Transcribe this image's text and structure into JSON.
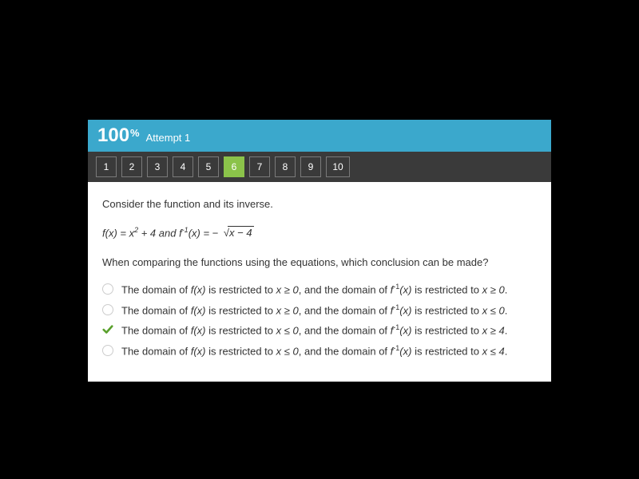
{
  "header": {
    "score": "100",
    "percent": "%",
    "attempt": "Attempt 1"
  },
  "nav": {
    "items": [
      "1",
      "2",
      "3",
      "4",
      "5",
      "6",
      "7",
      "8",
      "9",
      "10"
    ],
    "active_index": 5
  },
  "content": {
    "prompt": "Consider the function and its inverse.",
    "eq_fx_pre": "f(x) = x",
    "eq_fx_sup": "2",
    "eq_fx_mid": " + 4  and  f",
    "eq_finv_sup": "-1",
    "eq_finv_mid": "(x) =  − ",
    "eq_sqrt_body": "x − 4",
    "question": "When comparing the functions using the equations, which conclusion can be made?",
    "options": [
      {
        "correct": false,
        "text_pre": "The domain of ",
        "fx": "f(x)",
        "mid1": " is restricted to ",
        "cond1": "x ≥ 0",
        "mid2": ", and the domain of ",
        "finv_pre": "f",
        "finv_sup": "-1",
        "finv_post": "(x)",
        "mid3": " is restricted to  ",
        "cond2": "x ≥ 0",
        "end": "."
      },
      {
        "correct": false,
        "text_pre": "The domain of ",
        "fx": "f(x)",
        "mid1": " is restricted to ",
        "cond1": "x ≥ 0",
        "mid2": ", and the domain of ",
        "finv_pre": "f",
        "finv_sup": "-1",
        "finv_post": "(x)",
        "mid3": " is restricted to  ",
        "cond2": "x ≤ 0",
        "end": "."
      },
      {
        "correct": true,
        "text_pre": " The domain of ",
        "fx": "f(x)",
        "mid1": " is restricted to ",
        "cond1": "x ≤ 0",
        "mid2": ", and the domain of ",
        "finv_pre": "f",
        "finv_sup": "-1",
        "finv_post": "(x)",
        "mid3": " is restricted to  ",
        "cond2": "x ≥ 4",
        "end": "."
      },
      {
        "correct": false,
        "text_pre": "The domain of ",
        "fx": "f(x)",
        "mid1": " is restricted to ",
        "cond1": "x ≤ 0",
        "mid2": ", and the domain of ",
        "finv_pre": "f",
        "finv_sup": "-1",
        "finv_post": "(x)",
        "mid3": " is restricted to  ",
        "cond2": "x ≤ 4",
        "end": "."
      }
    ]
  }
}
